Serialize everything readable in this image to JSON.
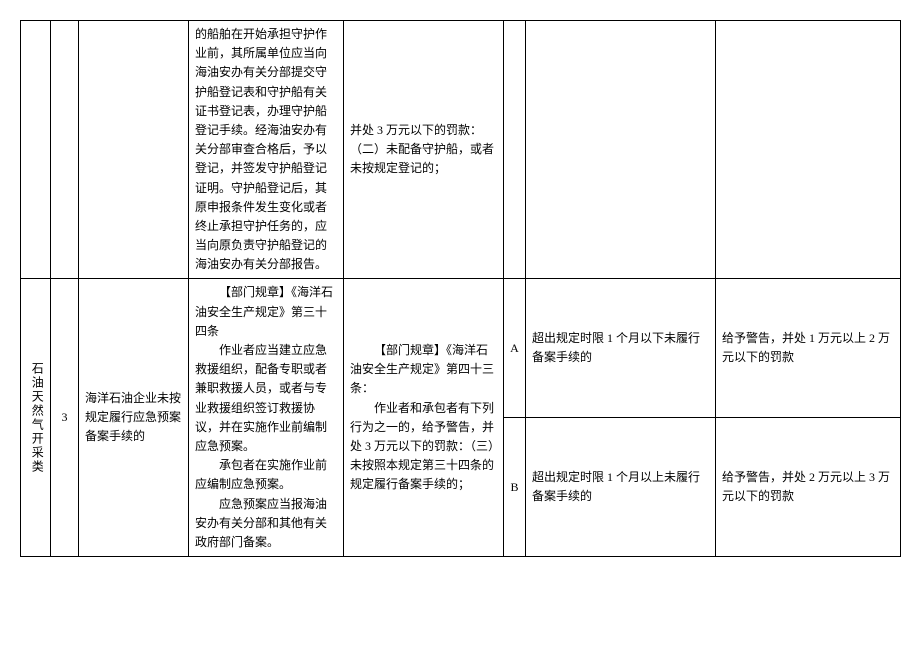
{
  "row1": {
    "regulation_basis": "的船舶在开始承担守护作业前，其所属单位应当向海油安办有关分部提交守护船登记表和守护船有关证书登记表，办理守护船登记手续。经海油安办有关分部审查合格后，予以登记，并签发守护船登记证明。守护船登记后，其原申报条件发生变化或者终止承担守护任务的，应当向原负责守护船登记的海油安办有关分部报告。",
    "penalty_basis": "并处 3 万元以下的罚款：（二）未配备守护船，或者未按规定登记的；"
  },
  "row2": {
    "category": "石油天然气开采类",
    "seq": "3",
    "violation": "海洋石油企业未按规定履行应急预案备案手续的",
    "regulation_basis_p1": "【部门规章】《海洋石油安全生产规定》第三十四条",
    "regulation_basis_p2": "作业者应当建立应急救援组织，配备专职或者兼职救援人员，或者与专业救援组织签订救援协议，并在实施作业前编制应急预案。",
    "regulation_basis_p3": "承包者在实施作业前应编制应急预案。",
    "regulation_basis_p4": "应急预案应当报海油安办有关分部和其他有关政府部门备案。",
    "penalty_basis_p1": "【部门规章】《海洋石油安全生产规定》第四十三条：",
    "penalty_basis_p2": "作业者和承包者有下列行为之一的，给予警告，并处 3 万元以下的罚款：（三）未按照本规定第三十四条的规定履行备案手续的；",
    "gradeA": "A",
    "gradeA_situation": "超出规定时限 1 个月以下未履行备案手续的",
    "gradeA_penalty": "给予警告，并处 1 万元以上 2 万元以下的罚款",
    "gradeB": "B",
    "gradeB_situation": "超出规定时限 1 个月以上未履行备案手续的",
    "gradeB_penalty": "给予警告，并处 2 万元以上 3 万元以下的罚款"
  }
}
